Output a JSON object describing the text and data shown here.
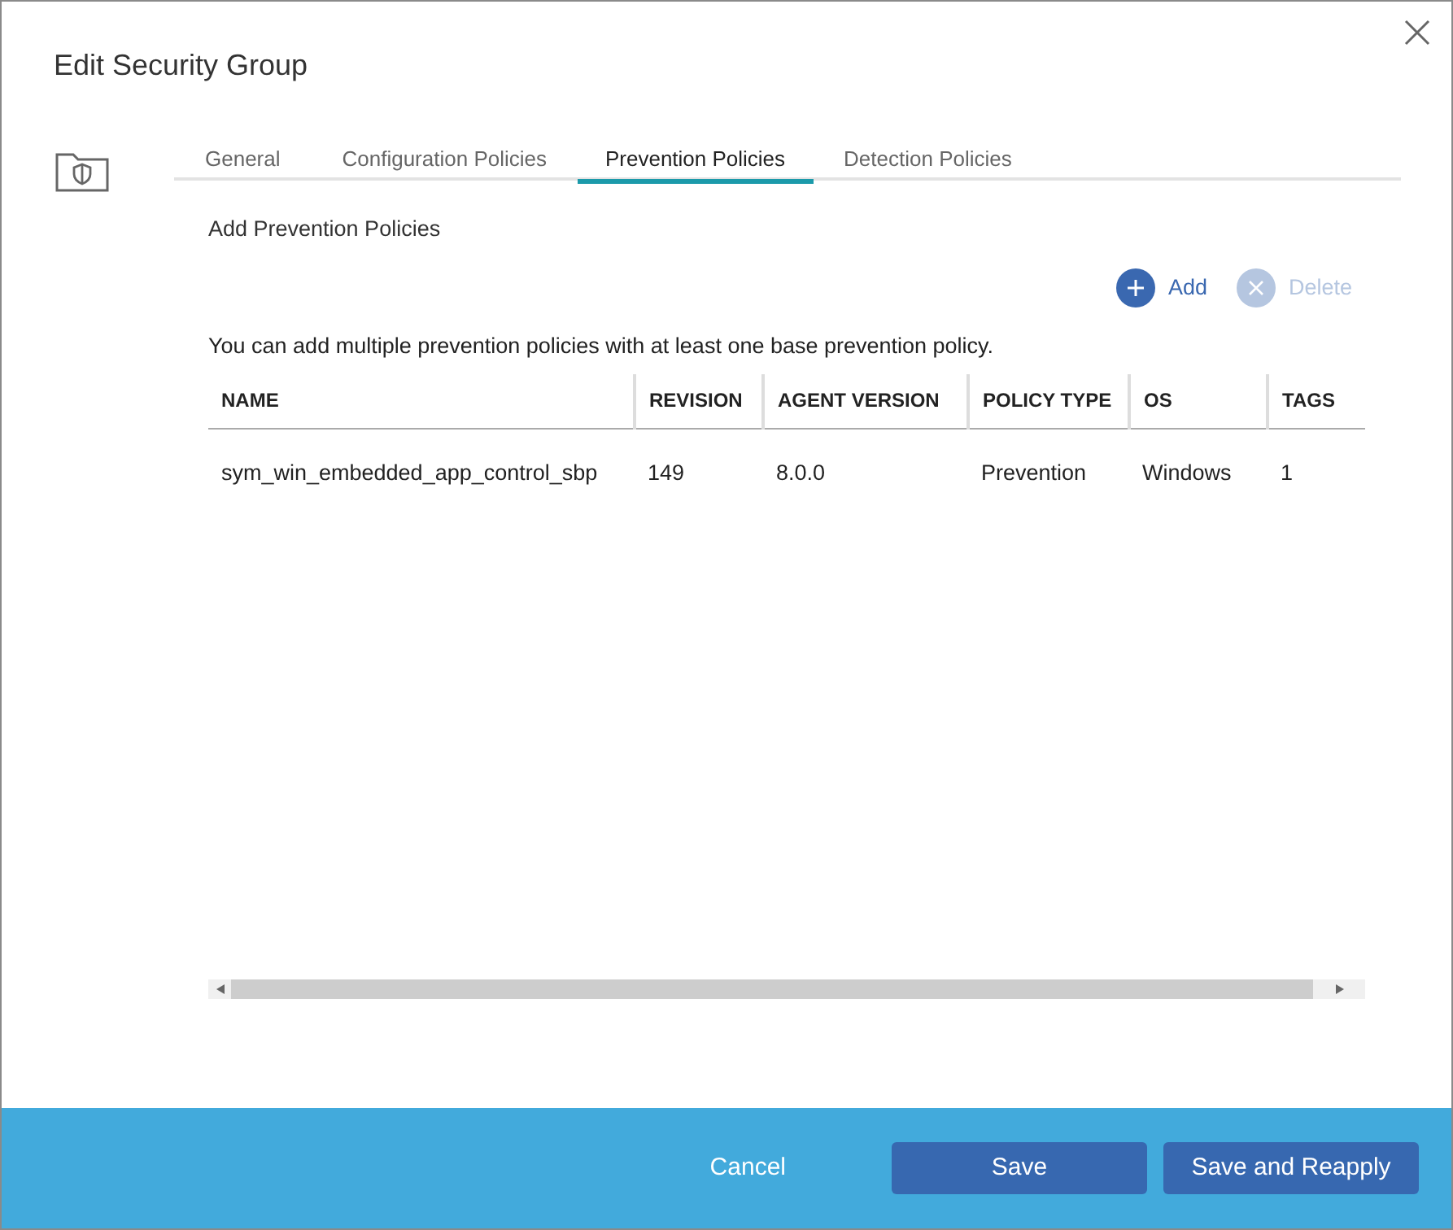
{
  "dialog": {
    "title": "Edit Security Group"
  },
  "tabs": [
    {
      "label": "General",
      "selected": false
    },
    {
      "label": "Configuration Policies",
      "selected": false
    },
    {
      "label": "Prevention Policies",
      "selected": true
    },
    {
      "label": "Detection Policies",
      "selected": false
    }
  ],
  "section_title": "Add Prevention Policies",
  "actions": [
    {
      "label": "Add",
      "kind": "add",
      "disabled": false
    },
    {
      "label": "Delete",
      "kind": "delete",
      "disabled": true
    }
  ],
  "hint": "You can add multiple prevention policies with at least one base prevention policy.",
  "table": {
    "columns": [
      "NAME",
      "REVISION",
      "AGENT VERSION",
      "POLICY TYPE",
      "OS",
      "TAGS"
    ],
    "rows": [
      [
        "sym_win_embedded_app_control_sbp",
        "149",
        "8.0.0",
        "Prevention",
        "Windows",
        "1"
      ]
    ]
  },
  "footer": {
    "buttons": [
      {
        "label": "Cancel",
        "kind": "link"
      },
      {
        "label": "Save",
        "kind": "primary"
      },
      {
        "label": "Save and Reapply",
        "kind": "primary"
      }
    ]
  }
}
